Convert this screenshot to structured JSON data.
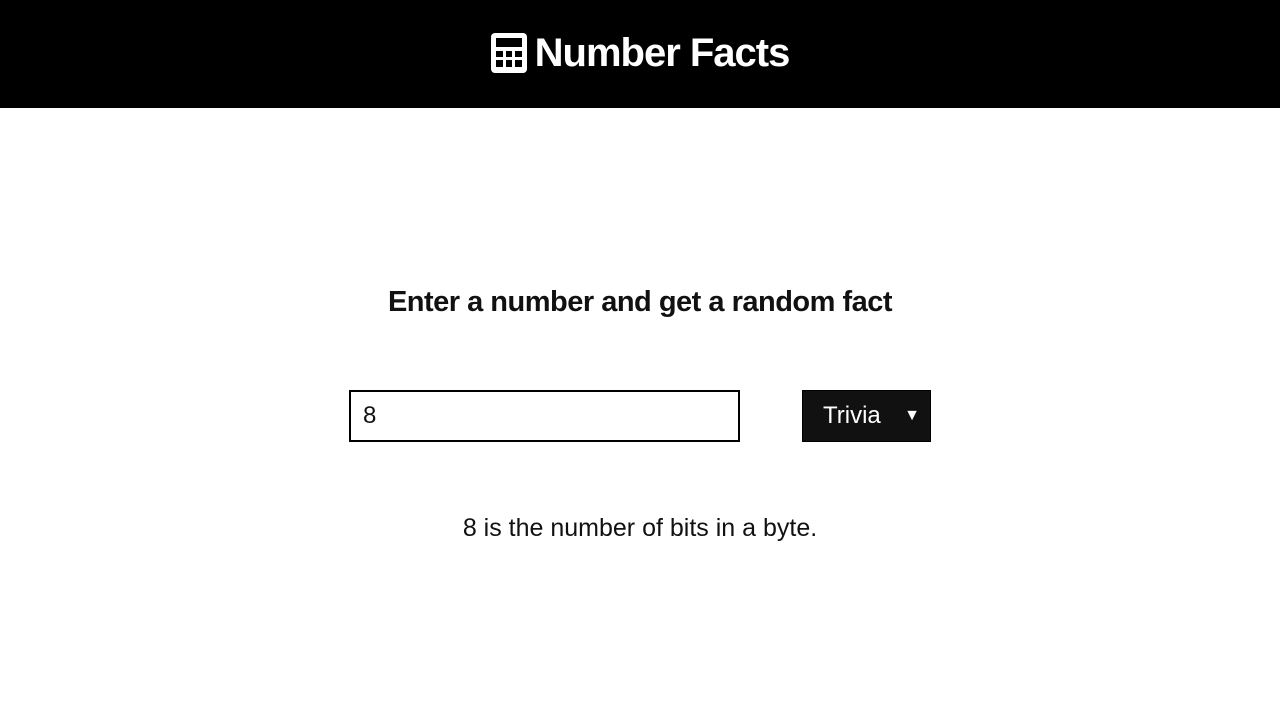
{
  "header": {
    "icon": "calculator-icon",
    "title": "Number Facts",
    "background": "#000000",
    "text_color": "#ffffff"
  },
  "main": {
    "heading": "Enter a number and get a random fact",
    "number_input": {
      "value": "8",
      "placeholder": ""
    },
    "type_select": {
      "selected": "Trivia",
      "background": "#111111"
    },
    "fact": "8 is the number of bits in a byte."
  }
}
